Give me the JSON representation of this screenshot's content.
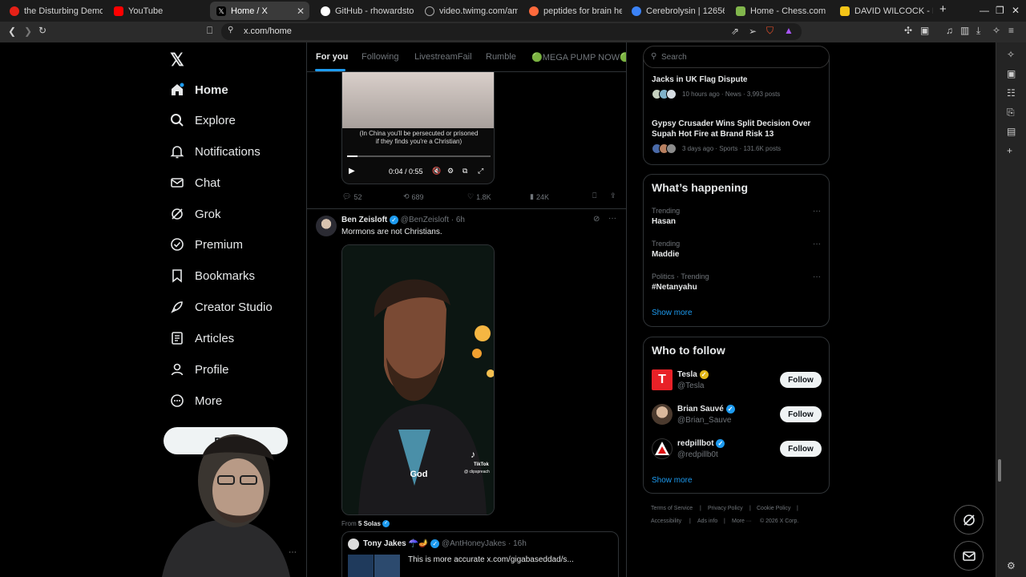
{
  "browser": {
    "tabs": [
      {
        "title": "the Disturbing Demonc",
        "color": "#e62117"
      },
      {
        "title": "YouTube",
        "color": "#ff0000"
      },
      {
        "title": "Home / X",
        "color": "#ffffff",
        "active": true
      },
      {
        "title": "GitHub - rhowardstone/",
        "color": "#ffffff"
      },
      {
        "title": "video.twimg.com/amplif",
        "color": "#aaaaaa"
      },
      {
        "title": "peptides for brain heali",
        "color": "#ff6a3c"
      },
      {
        "title": "Cerebrolysin | 12656-6",
        "color": "#3b82f6"
      },
      {
        "title": "Home - Chess.com",
        "color": "#81b64c"
      },
      {
        "title": "DAVID WILCOCK - Discl",
        "color": "#f5c518"
      }
    ],
    "new_tab": "+",
    "url": "x.com/home"
  },
  "nav": {
    "items": [
      {
        "label": "Home",
        "icon": "home-icon"
      },
      {
        "label": "Explore",
        "icon": "search-icon"
      },
      {
        "label": "Notifications",
        "icon": "bell-icon"
      },
      {
        "label": "Chat",
        "icon": "mail-icon"
      },
      {
        "label": "Grok",
        "icon": "grok-icon"
      },
      {
        "label": "Premium",
        "icon": "premium-icon"
      },
      {
        "label": "Bookmarks",
        "icon": "bookmark-icon"
      },
      {
        "label": "Creator Studio",
        "icon": "rocket-icon"
      },
      {
        "label": "Articles",
        "icon": "article-icon"
      },
      {
        "label": "Profile",
        "icon": "person-icon"
      },
      {
        "label": "More",
        "icon": "more-icon"
      }
    ],
    "post_button": "Post"
  },
  "feed": {
    "tabs": [
      "For you",
      "Following",
      "LivestreamFail",
      "Rumble",
      "🟢MEGA PUMP NOW🟢"
    ],
    "post1": {
      "caption_line1": "(In China you'll be persecuted or prisoned",
      "caption_line2": "if they finds you're a Christian)",
      "time": "0:04 / 0:55",
      "replies": "52",
      "reposts": "689",
      "likes": "1.8K",
      "views": "24K"
    },
    "post2": {
      "name": "Ben Zeisloft",
      "handle": "@BenZeisloft",
      "age": "· 6h",
      "text": "Mormons are not Christians.",
      "video_caption": "God",
      "watermark": "TikTok",
      "watermark_handle": "@ clipspreach",
      "from_label": "From",
      "from_name": "5 Solas"
    },
    "quote": {
      "name": "Tony Jakes ☂️🪔",
      "handle": "@AntHoneyJakes",
      "age": "· 16h",
      "text": "This is more accurate  x.com/gigabaseddad/s..."
    }
  },
  "right": {
    "search_placeholder": "Search",
    "news": [
      {
        "title": "Jacks in UK Flag Dispute",
        "meta": "10 hours ago · News · 3,993 posts"
      },
      {
        "title": "Gypsy Crusader Wins Split Decision Over Supah Hot Fire at Brand Risk 13",
        "meta": "3 days ago · Sports · 131.6K posts"
      }
    ],
    "happening_title": "What’s happening",
    "trends": [
      {
        "meta": "Trending",
        "name": "Hasan"
      },
      {
        "meta": "Trending",
        "name": "Maddie"
      },
      {
        "meta": "Politics · Trending",
        "name": "#Netanyahu"
      }
    ],
    "show_more": "Show more",
    "who_title": "Who to follow",
    "who": [
      {
        "name": "Tesla",
        "handle": "@Tesla",
        "badge": "gold",
        "follow": "Follow"
      },
      {
        "name": "Brian Sauvé",
        "handle": "@Brian_Sauve",
        "badge": "blue",
        "follow": "Follow"
      },
      {
        "name": "redpillbot",
        "handle": "@redpillb0t",
        "badge": "blue",
        "follow": "Follow"
      }
    ],
    "show_more_2": "Show more",
    "footer": [
      "Terms of Service",
      "|",
      "Privacy Policy",
      "|",
      "Cookie Policy",
      "|",
      "Accessibility",
      "|",
      "Ads info",
      "|",
      "More ···",
      "© 2026 X Corp."
    ]
  }
}
